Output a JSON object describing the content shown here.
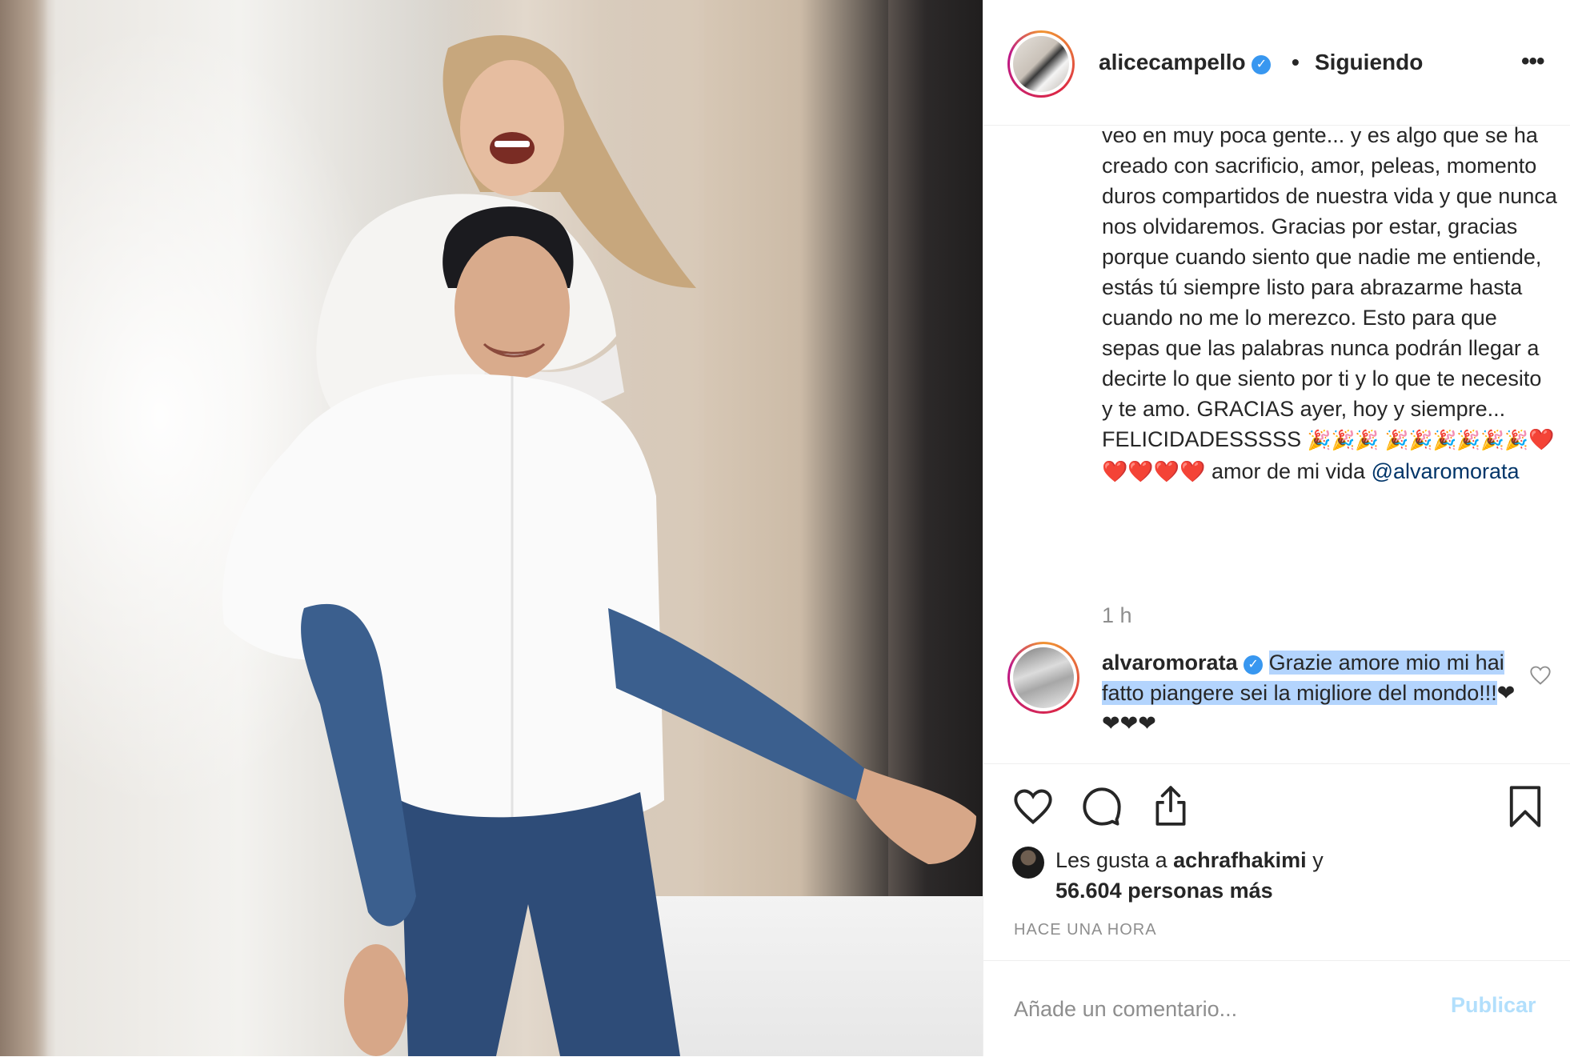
{
  "post": {
    "username": "alicecampello",
    "verified_icon": "verified-badge-icon",
    "separator": "•",
    "follow_state": "Siguiendo",
    "more_options": "•••",
    "caption": {
      "text": "veo en muy poca gente... y es algo que se ha creado con sacrificio, amor, peleas, momento duros compartidos de nuestra vida y que nunca nos olvidaremos. Gracias por estar, gracias porque cuando siento que nadie me entiende, estás tú siempre listo para abrazarme hasta cuando no me lo merezco. Esto para que sepas que las palabras nunca podrán llegar a decirte lo que siento por ti y lo que te necesito y te amo. GRACIAS ayer, hoy y siempre... FELICIDADESSSSS",
      "party_emojis_1": "🎉🎉🎉",
      "party_emojis_2": "🎉🎉🎉🎉🎉🎉",
      "hearts": "❤️❤️❤️❤️❤️",
      "suffix": " amor de mi vida ",
      "mention": "@alvaromorata",
      "time": "1 h"
    },
    "comment": {
      "username": "alvaromorata",
      "text_highlighted": "Grazie amore mio mi hai fatto piangere sei la migliore del mondo!!!",
      "text_trailing": "❤❤❤❤"
    },
    "likes": {
      "prefix": "Les gusta a ",
      "liker": "achrafhakimi",
      "connector": " y",
      "others": "56.604 personas más"
    },
    "timestamp": "HACE UNA HORA",
    "add_comment": {
      "placeholder": "Añade un comentario...",
      "publish_label": "Publicar"
    }
  },
  "colors": {
    "text": "#262626",
    "secondary": "#8e8e8e",
    "mention": "#003569",
    "verified": "#3897f0",
    "selection": "#b3d4fd",
    "publish_disabled": "#b2dffc",
    "heart": "#e0245e"
  },
  "icons": [
    "like-icon",
    "comment-icon",
    "share-icon",
    "save-icon",
    "more-icon",
    "small-heart-icon"
  ]
}
